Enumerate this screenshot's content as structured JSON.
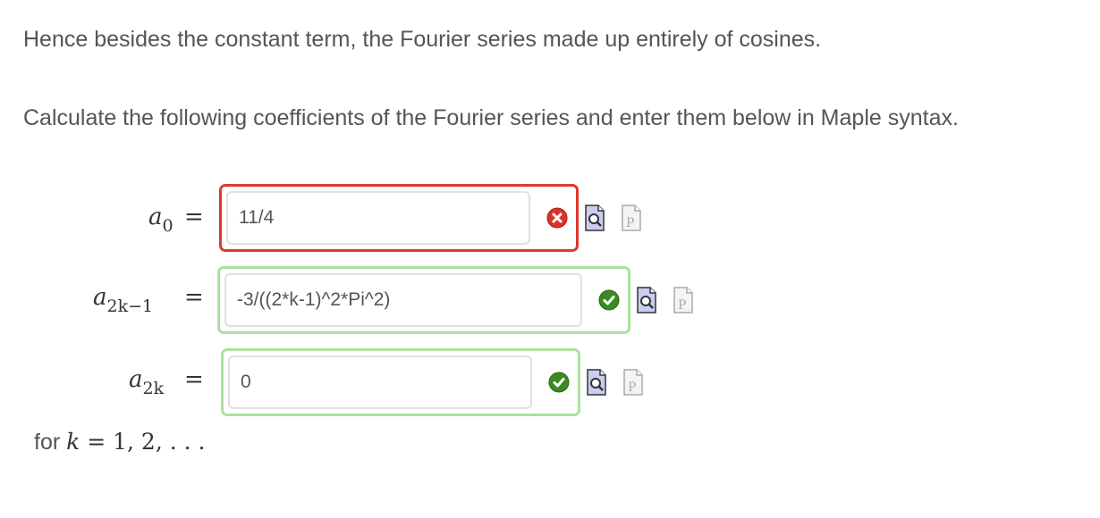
{
  "text": {
    "line1": "Hence besides the constant term, the Fourier series made up entirely of cosines.",
    "line2": "Calculate the following coefficients of the Fourier series and enter them below in Maple syntax."
  },
  "rows": [
    {
      "label_base": "a",
      "label_sub": "0",
      "equals": "=",
      "value": "11/4",
      "status": "incorrect",
      "status_icon": "x-circle-icon",
      "colors": {
        "frame": "#de3a31",
        "status": "#d9342a"
      }
    },
    {
      "label_base": "a",
      "label_sub": "2k−1",
      "equals": "=",
      "value": "-3/((2*k-1)^2*Pi^2)",
      "status": "correct",
      "status_icon": "check-circle-icon",
      "colors": {
        "frame": "#a9e29c",
        "status": "#3b8a1f"
      }
    },
    {
      "label_base": "a",
      "label_sub": "2k",
      "equals": "=",
      "value": "0",
      "status": "correct",
      "status_icon": "check-circle-icon",
      "colors": {
        "frame": "#a9e29c",
        "status": "#3b8a1f"
      }
    }
  ],
  "footer": {
    "prefix": "for ",
    "var": "k",
    "rest": " = 1, 2, . . ."
  },
  "icons": [
    "preview-icon",
    "maple-syntax-icon"
  ]
}
